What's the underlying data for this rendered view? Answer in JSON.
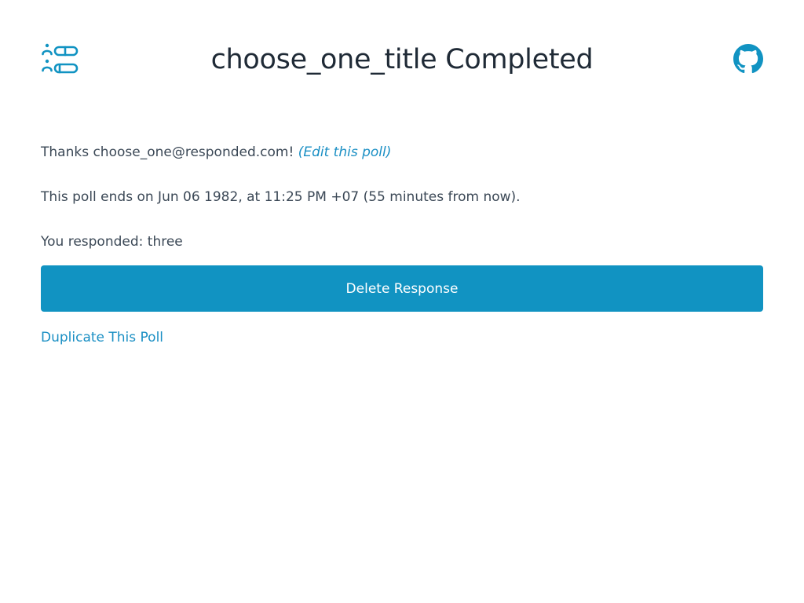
{
  "header": {
    "title": "choose_one_title Completed",
    "logo_icon": "poll-list-icon",
    "github_icon": "github-icon"
  },
  "poll": {
    "thanks_prefix": "Thanks choose_one@responded.com!",
    "edit_link_label": "(Edit this poll)",
    "ends_text": "This poll ends on Jun 06 1982, at 11:25 PM +07 (55 minutes from now).",
    "response_text": "You responded: three",
    "delete_button_label": "Delete Response",
    "duplicate_link_label": "Duplicate This Poll"
  },
  "colors": {
    "accent": "#1193c2",
    "link": "#1a8fc4",
    "text": "#3b4856",
    "title": "#1f2a36",
    "background": "#ffffff"
  }
}
